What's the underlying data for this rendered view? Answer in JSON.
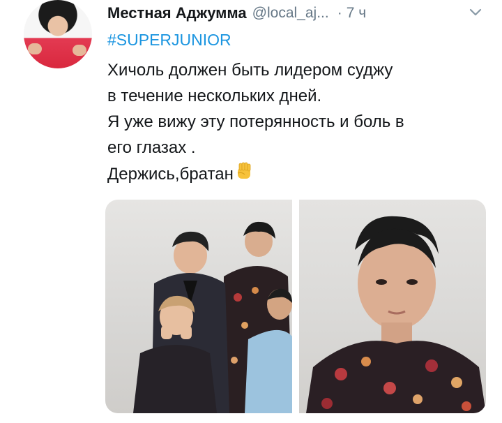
{
  "tweet": {
    "display_name": "Местная Аджумма",
    "handle": "@local_aj...",
    "separator": "·",
    "time": "7 ч",
    "hashtag": "#SUPERJUNIOR",
    "text_lines": [
      "Хичоль должен  быть лидером суджу",
      "в течение нескольких дней.",
      "Я уже вижу эту потерянность и боль в",
      "его глазах .",
      "Держись,братан"
    ],
    "emoji": "raised-fist-emoji"
  },
  "media": {
    "photos": [
      "group-photo",
      "closeup-photo"
    ]
  },
  "colors": {
    "link": "#1b95e0",
    "secondary_text": "#657786",
    "primary_text": "#14171a"
  }
}
